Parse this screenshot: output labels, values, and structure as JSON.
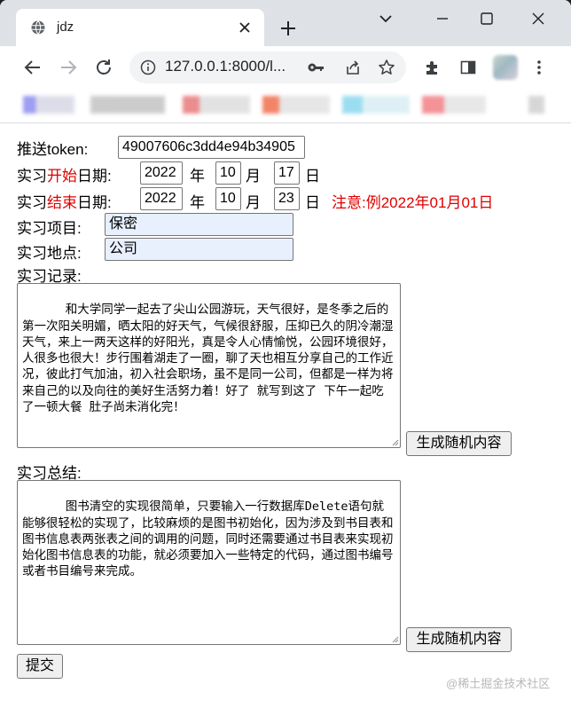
{
  "browser": {
    "tab_title": "jdz",
    "url": "127.0.0.1:8000/l...",
    "icons": [
      "globe-icon",
      "close-icon",
      "plus-icon",
      "chevron-down-icon",
      "minimize-icon",
      "maximize-icon",
      "window-close-icon",
      "back-arrow-icon",
      "forward-arrow-icon",
      "reload-icon",
      "info-icon",
      "key-icon",
      "share-icon",
      "star-icon",
      "puzzle-icon",
      "side-panel-icon",
      "kebab-menu-icon"
    ]
  },
  "form": {
    "token_label": "推送token:",
    "token_value": "49007606c3dd4e94b34905",
    "start": {
      "label_prefix": "实习",
      "label_highlight": "开始",
      "label_suffix": "日期:",
      "year": "2022",
      "year_unit": "年",
      "month": "10",
      "month_unit": "月",
      "day": "17",
      "day_unit": "日"
    },
    "end": {
      "label_prefix": "实习",
      "label_highlight": "结束",
      "label_suffix": "日期:",
      "year": "2022",
      "year_unit": "年",
      "month": "10",
      "month_unit": "月",
      "day": "23",
      "day_unit": "日",
      "note": "注意:例2022年01月01日"
    },
    "project_label": "实习项目:",
    "project_value": "保密",
    "location_label": "实习地点:",
    "location_value": "公司",
    "record_label": "实习记录:",
    "record_text": "和大学同学一起去了尖山公园游玩，天气很好，是冬季之后的第一次阳关明媚，晒太阳的好天气，气候很舒服，压抑已久的阴冷潮湿天气，来上一两天这样的好阳光，真是令人心情愉悦，公园环境很好，人很多也很大！步行围着湖走了一圈，聊了天也相互分享自己的工作近况，彼此打气加油，初入社会职场，虽不是同一公司，但都是一样为将来自己的以及向往的美好生活努力着！好了 就写到这了 下午一起吃了一顿大餐 肚子尚未消化完！",
    "random_button": "生成随机内容",
    "summary_label": "实习总结:",
    "summary_text": "图书清空的实现很简单，只要输入一行数据库Delete语句就能够很轻松的实现了，比较麻烦的是图书初始化，因为涉及到书目表和图书信息表两张表之间的调用的问题，同时还需要通过书目表来实现初始化图书信息表的功能，就必须要加入一些特定的代码，通过图书编号或者书目编号来完成。",
    "random_button_2": "生成随机内容",
    "submit_button": "提交"
  },
  "watermark": "@稀土掘金技术社区",
  "colors": {
    "highlight_red": "#e00000",
    "autofill_blue": "#e8f0fe",
    "tabstrip": "#dee1e6"
  }
}
